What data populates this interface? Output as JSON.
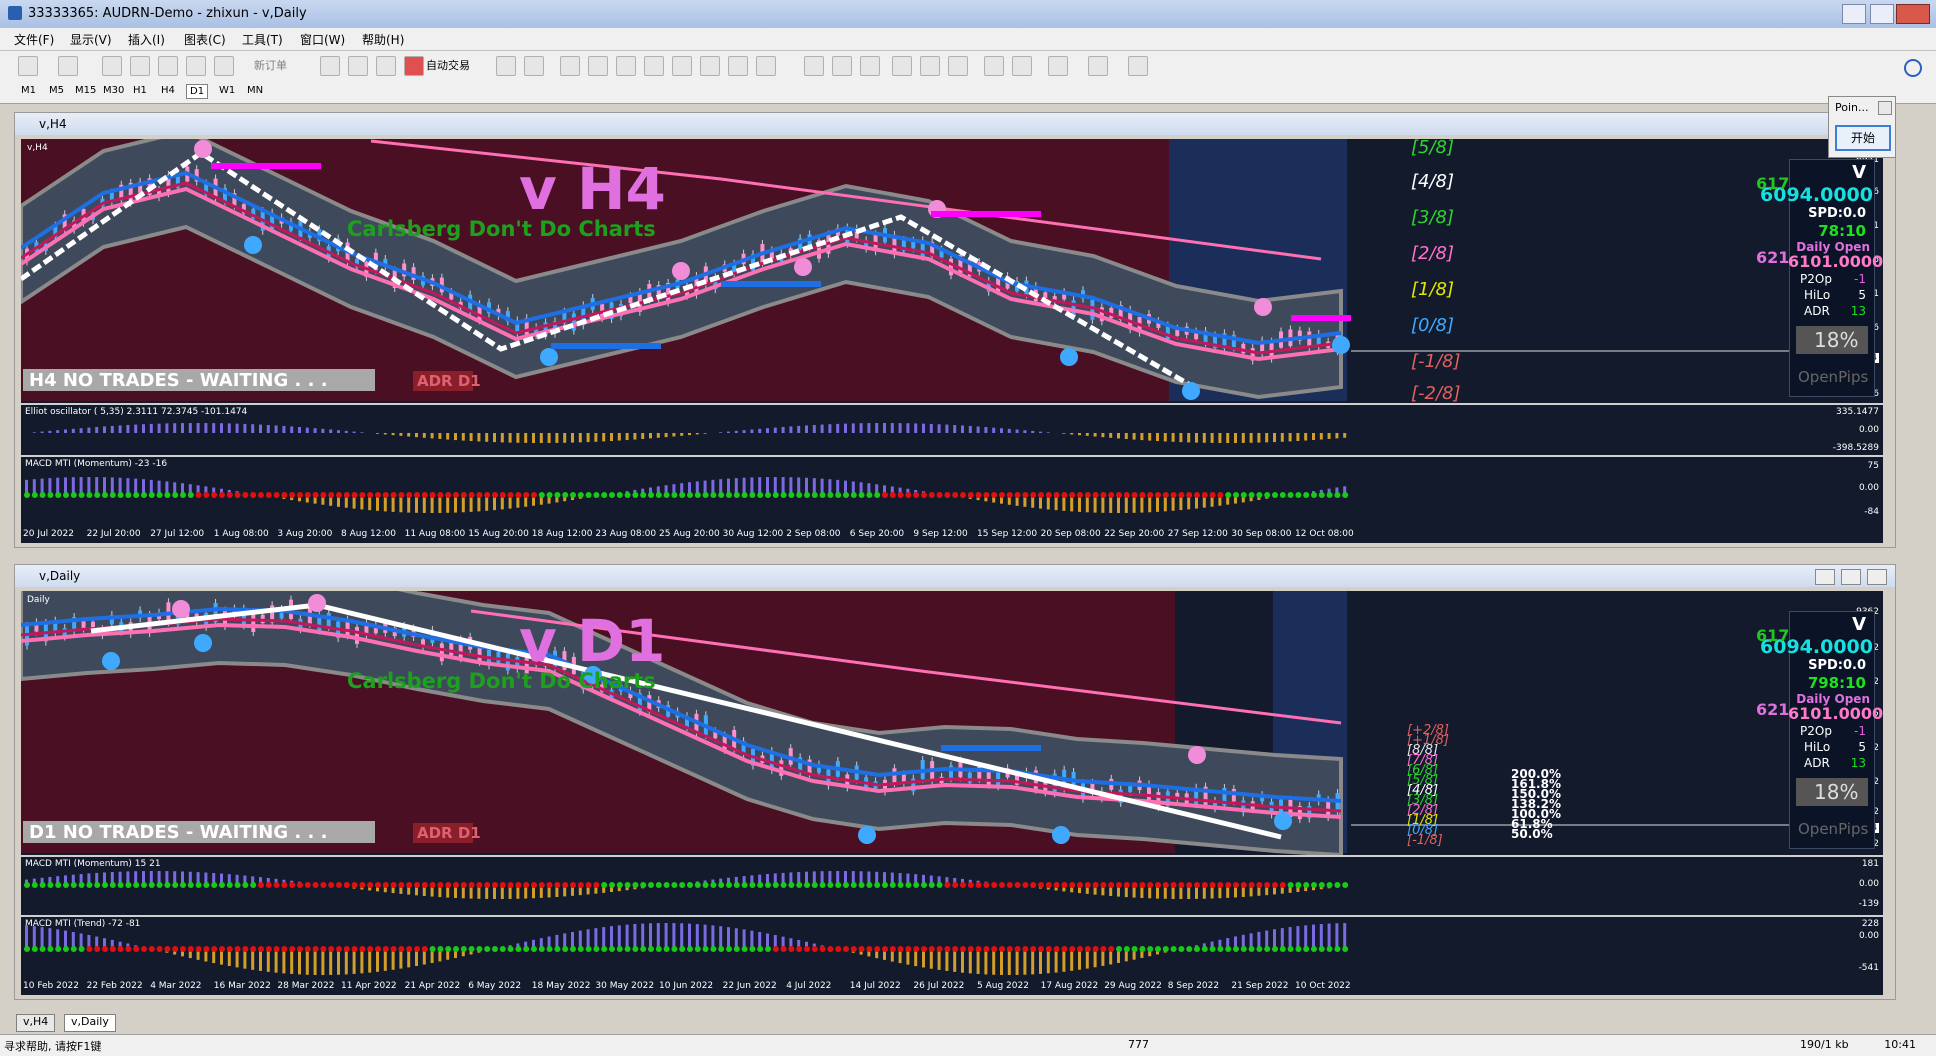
{
  "window": {
    "title": "33333365: AUDRN-Demo - zhixun - v,Daily"
  },
  "menu": [
    "文件(F)",
    "显示(V)",
    "插入(I)",
    "图表(C)",
    "工具(T)",
    "窗口(W)",
    "帮助(H)"
  ],
  "toolbar": {
    "new_order": "新订单",
    "auto_trade": "自动交易"
  },
  "timeframes": [
    "M1",
    "M5",
    "M15",
    "M30",
    "H1",
    "H4",
    "D1",
    "W1",
    "MN"
  ],
  "popup": {
    "title": "Poin...",
    "button": "开始"
  },
  "h4": {
    "window_title": "v,H4",
    "symbol_label": "v,H4",
    "big_label": "v  H4",
    "tagline": "Carlsberg Don't Do Charts",
    "status_banner": "H4  NO TRADES - WAITING . . .",
    "adr_badge": "ADR D1",
    "levels": [
      "[5/8]",
      "[4/8]",
      "[3/8]",
      "[2/8]",
      "[1/8]",
      "[0/8]",
      "[-1/8]",
      "[-2/8]"
    ],
    "yaxis": [
      "6951",
      "6806",
      "6661",
      "6516",
      "6371",
      "6226",
      "6094",
      "5936"
    ],
    "osc_label": "Elliot oscillator ( 5,35) 2.3111 72.3745 -101.1474",
    "osc_yaxis": [
      "335.1477",
      "0.00",
      "-398.5289"
    ],
    "macd_label": "MACD MTI (Momentum) -23 -16",
    "macd_yaxis": [
      "75",
      "0.00",
      "-84"
    ],
    "dates": [
      "20 Jul 2022",
      "22 Jul 20:00",
      "27 Jul 12:00",
      "1 Aug 08:00",
      "3 Aug 20:00",
      "8 Aug 12:00",
      "11 Aug 08:00",
      "15 Aug 20:00",
      "18 Aug 12:00",
      "23 Aug 08:00",
      "25 Aug 20:00",
      "30 Aug 12:00",
      "2 Sep 08:00",
      "6 Sep 20:00",
      "9 Sep 12:00",
      "15 Sep 12:00",
      "20 Sep 08:00",
      "22 Sep 20:00",
      "27 Sep 12:00",
      "30 Sep 08:00",
      "12 Oct 08:00"
    ],
    "info": {
      "v": "V",
      "price": "6094.0000",
      "spd": "SPD:0.0",
      "time": "78:10",
      "daily_open_label": "Daily Open",
      "daily_open": "6101.0000",
      "p2op_label": "P2Op",
      "p2op": "-1",
      "hilo_label": "HiLo",
      "hilo": "5",
      "adr_label": "ADR",
      "adr": "13",
      "pct": "18%",
      "openpips": "OpenPips",
      "n617": "617",
      "n621": "621"
    }
  },
  "d1": {
    "window_title": "v,Daily",
    "symbol_label": "Daily",
    "big_label": "v  D1",
    "tagline": "Carlsberg Don't Do Charts",
    "status_banner": "D1  NO TRADES - WAITING . . .",
    "adr_badge": "ADR D1",
    "levels": [
      "[+2/8]",
      "[+1/8]",
      "[8/8]",
      "[7/8]",
      "[6/8]",
      "[5/8]",
      "[4/8]",
      "[3/8]",
      "[2/8]",
      "[1/8]",
      "[0/8]",
      "[-1/8]"
    ],
    "yaxis": [
      "9362",
      "8872",
      "8372",
      "7882",
      "7382",
      "6892",
      "6392",
      "6094",
      "5902"
    ],
    "pct_labels": [
      "200.0%",
      "161.8%",
      "150.0%",
      "138.2%",
      "100.0%",
      "61.8%",
      "50.0%"
    ],
    "macd1_label": "MACD MTI (Momentum) 15 21",
    "macd1_yaxis": [
      "181",
      "0.00",
      "-139"
    ],
    "macd2_label": "MACD MTI (Trend) -72 -81",
    "macd2_yaxis": [
      "228",
      "0.00",
      "-541"
    ],
    "dates": [
      "10 Feb 2022",
      "22 Feb 2022",
      "4 Mar 2022",
      "16 Mar 2022",
      "28 Mar 2022",
      "11 Apr 2022",
      "21 Apr 2022",
      "6 May 2022",
      "18 May 2022",
      "30 May 2022",
      "10 Jun 2022",
      "22 Jun 2022",
      "4 Jul 2022",
      "14 Jul 2022",
      "26 Jul 2022",
      "5 Aug 2022",
      "17 Aug 2022",
      "29 Aug 2022",
      "8 Sep 2022",
      "21 Sep 2022",
      "10 Oct 2022"
    ],
    "info": {
      "v": "V",
      "price": "6094.0000",
      "spd": "SPD:0.0",
      "time": "798:10",
      "daily_open_label": "Daily Open",
      "daily_open": "6101.0000",
      "p2op_label": "P2Op",
      "p2op": "-1",
      "hilo_label": "HiLo",
      "hilo": "5",
      "adr_label": "ADR",
      "adr": "13",
      "pct": "18%",
      "openpips": "OpenPips",
      "n617": "617",
      "n621": "621"
    }
  },
  "tabs": [
    "v,H4",
    "v,Daily"
  ],
  "status": {
    "help": "寻求帮助, 请按F1键",
    "mid": "777",
    "right": "190/1 kb",
    "clock": "10:41"
  },
  "colors": {
    "panel_bg": "#121a2b",
    "maroon": "#4a0f22",
    "band": "#3e4a5c",
    "navy": "#1b2e5a",
    "pink": "#ff6fb4",
    "blue": "#1e6fe6",
    "magenta": "#ff00ff",
    "green": "#19c819",
    "teal": "#00e6e6"
  }
}
